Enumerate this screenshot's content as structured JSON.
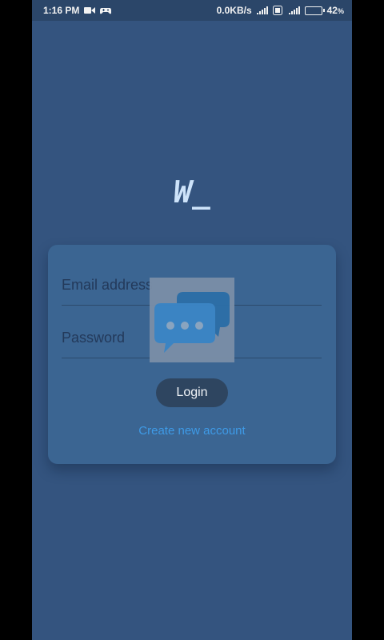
{
  "status_bar": {
    "time": "1:16 PM",
    "network_speed": "0.0KB/s",
    "battery_percent": "42",
    "battery_level": 0.42,
    "icons": [
      "video-camera-icon",
      "game-controller-icon",
      "signal-icon",
      "volte-icon",
      "4g-signal-icon",
      "battery-icon"
    ]
  },
  "logo": {
    "text": "W_"
  },
  "login_form": {
    "email_placeholder": "Email address",
    "password_placeholder": "Password",
    "login_label": "Login",
    "create_account_label": "Create new account"
  },
  "overlay": {
    "icon": "chat-bubbles-icon"
  },
  "colors": {
    "background": "#34547f",
    "card": "#3b6592",
    "button": "#2e4560",
    "link": "#3e9ae6",
    "logo": "#cde3fa"
  }
}
